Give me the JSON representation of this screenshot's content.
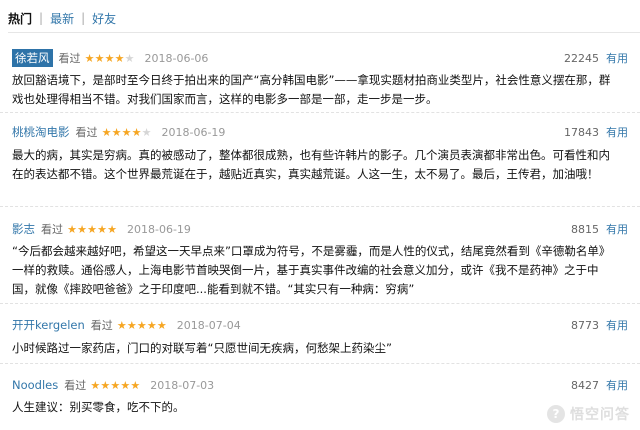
{
  "tabs": [
    {
      "label": "热门",
      "active": true
    },
    {
      "label": "最新",
      "active": false
    },
    {
      "label": "好友",
      "active": false
    }
  ],
  "tab_separator": "|",
  "colors": {
    "link": "#3377aa",
    "star": "#f6a623",
    "highlight": "#2e73a8"
  },
  "reviews": [
    {
      "user": "徐若风",
      "status": "看过",
      "rating": 4,
      "date": "2018-06-06",
      "votes": "22245",
      "useful_label": "有用",
      "body": "放回豁语境下，是部时至今日终于拍出来的国产“高分韩国电影”——拿现实题材拍商业类型片，社会性意义摆在那，群戏也处理得相当不错。对我们国家而言，这样的电影多一部是一部，走一步是一步。"
    },
    {
      "user": "桃桃淘电影",
      "status": "看过",
      "rating": 4,
      "date": "2018-06-19",
      "votes": "17843",
      "useful_label": "有用",
      "body": "最大的病，其实是穷病。真的被感动了，整体都很成熟，也有些许韩片的影子。几个演员表演都非常出色。可看性和内在的表达都不错。这个世界最荒诞在于，越贴近真实，真实越荒诞。人这一生，太不易了。最后，王传君，加油哦！"
    },
    {
      "user": "影志",
      "status": "看过",
      "rating": 5,
      "date": "2018-06-19",
      "votes": "8815",
      "useful_label": "有用",
      "body": "“今后都会越来越好吧，希望这一天早点来”口罩成为符号，不是雾霾，而是人性的仪式，结尾竟然看到《辛德勒名单》一样的救赎。通俗感人，上海电影节首映哭倒一片，基于真实事件改编的社会意义加分，或许《我不是药神》之于中国，就像《摔跤吧爸爸》之于印度吧...能看到就不错。“其实只有一种病：穷病”"
    },
    {
      "user": "开开kergelen",
      "status": "看过",
      "rating": 5,
      "date": "2018-07-04",
      "votes": "8773",
      "useful_label": "有用",
      "body": "小时候路过一家药店，门口的对联写着“只愿世间无疾病，何愁架上药染尘”"
    },
    {
      "user": "Noodles",
      "status": "看过",
      "rating": 5,
      "date": "2018-07-03",
      "votes": "8427",
      "useful_label": "有用",
      "body": "人生建议：别买零食，吃不下的。"
    }
  ],
  "watermark": {
    "glyph": "?",
    "text": "悟空问答"
  }
}
